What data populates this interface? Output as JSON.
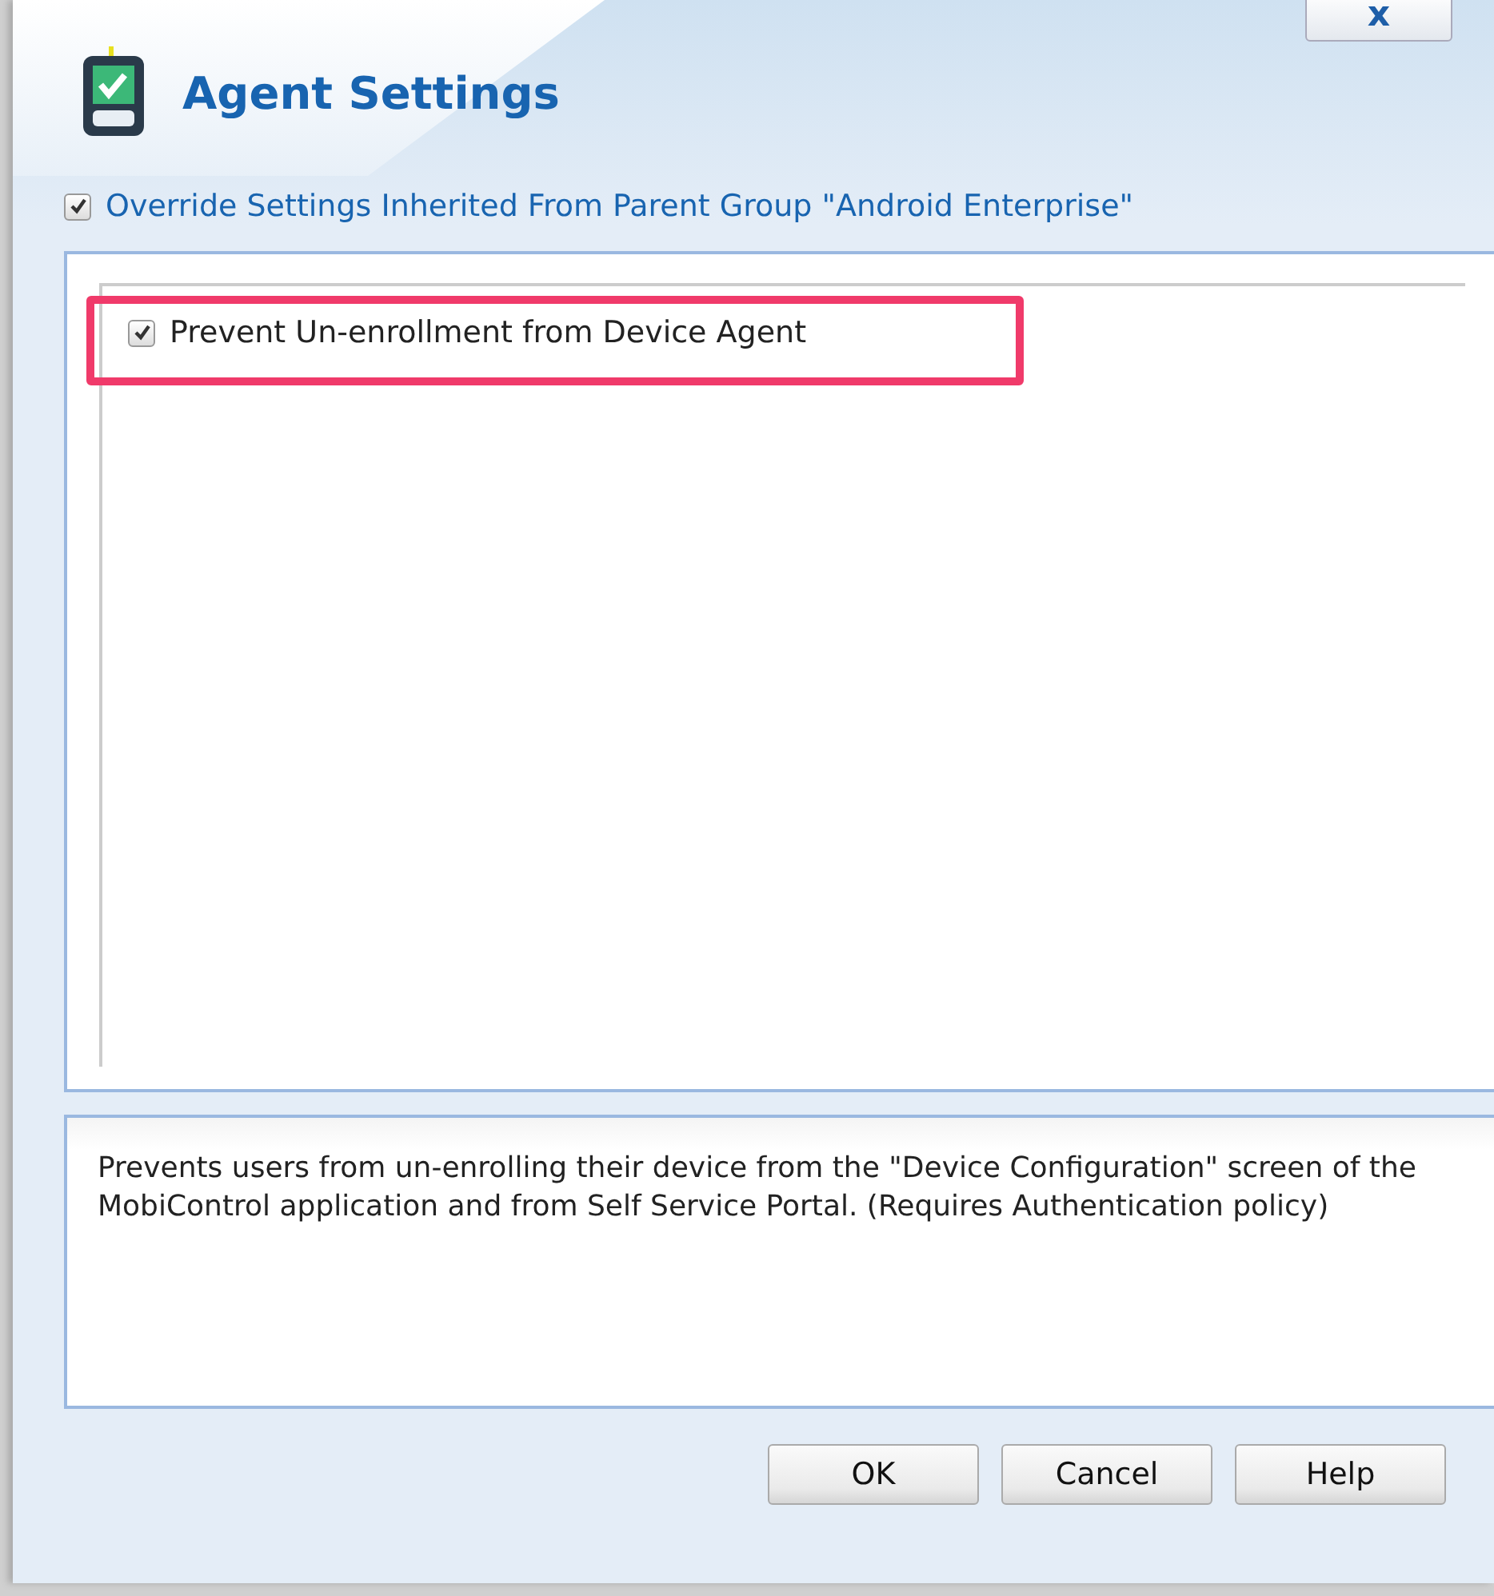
{
  "window": {
    "title": "Agent Settings",
    "close_label": "x"
  },
  "override": {
    "label": "Override Settings Inherited From Parent Group \"Android Enterprise\"",
    "checked": true
  },
  "options": [
    {
      "label": "Prevent Un-enrollment from Device Agent",
      "checked": true,
      "highlighted": true
    }
  ],
  "description": "Prevents users from un-enrolling their device from the \"Device Configuration\" screen of the MobiControl application and from Self Service Portal. (Requires Authentication policy)",
  "buttons": [
    "OK",
    "Cancel",
    "Help"
  ]
}
